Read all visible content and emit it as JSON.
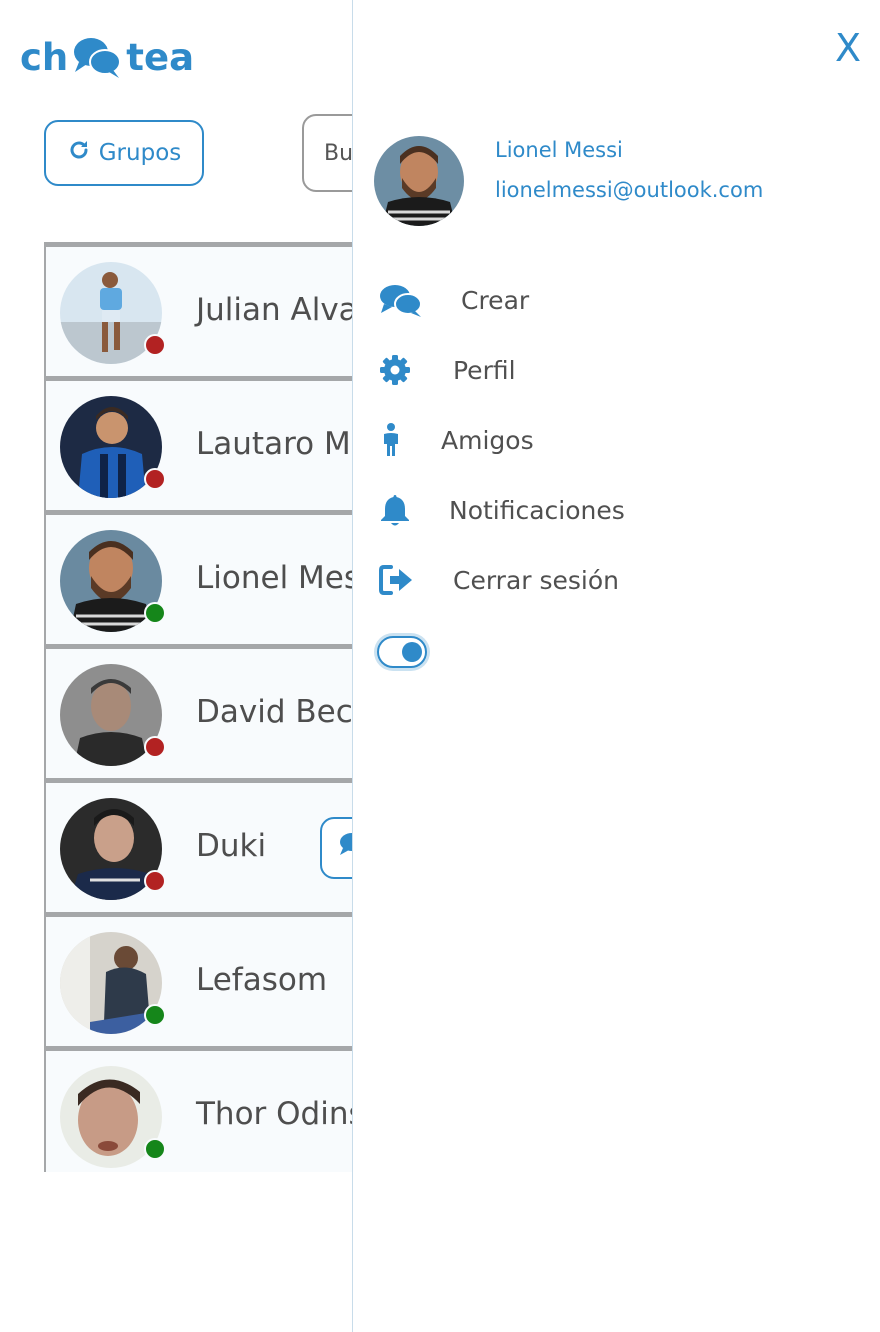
{
  "app": {
    "logo_left": "ch",
    "logo_right": "tea",
    "brand_color": "#2f8ac9"
  },
  "toolbar": {
    "groups_label": "Grupos",
    "groups_icon": "refresh-icon",
    "search_text": "Bu"
  },
  "contacts": [
    {
      "name": "Julian Alvar",
      "status": "offline",
      "status_color": "#b22222"
    },
    {
      "name": "Lautaro Ma",
      "status": "offline",
      "status_color": "#b22222"
    },
    {
      "name": "Lionel Mes",
      "status": "online",
      "status_color": "#15861a"
    },
    {
      "name": "David Beck",
      "status": "offline",
      "status_color": "#b22222"
    },
    {
      "name": "Duki",
      "status": "offline",
      "status_color": "#b22222"
    },
    {
      "name": "Lefasom",
      "status": "online",
      "status_color": "#15861a"
    },
    {
      "name": "Thor Odins",
      "status": "online",
      "status_color": "#15861a"
    }
  ],
  "side_menu": {
    "close_label": "X",
    "user": {
      "name": "Lionel Messi",
      "email": "lionelmessi@outlook.com"
    },
    "items": [
      {
        "label": "Crear",
        "icon": "chat-bubbles-icon"
      },
      {
        "label": "Perfil",
        "icon": "gear-icon"
      },
      {
        "label": "Amigos",
        "icon": "person-icon"
      },
      {
        "label": "Notificaciones",
        "icon": "bell-icon"
      },
      {
        "label": "Cerrar sesión",
        "icon": "logout-icon"
      }
    ],
    "dark_mode_toggle": {
      "on": true
    }
  }
}
